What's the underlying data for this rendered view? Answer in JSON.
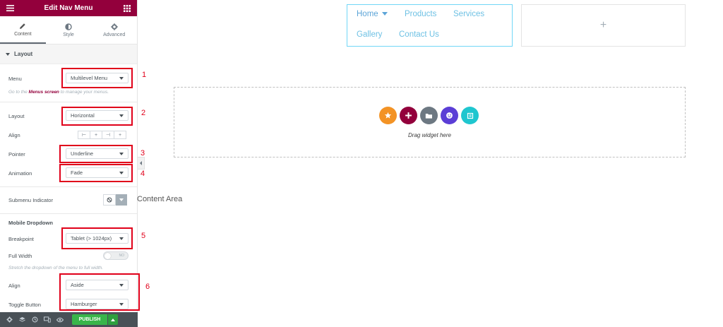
{
  "panel": {
    "title": "Edit Nav Menu",
    "tabs": [
      {
        "label": "Content",
        "icon": "pencil-icon",
        "active": true
      },
      {
        "label": "Style",
        "icon": "half-circle-icon",
        "active": false
      },
      {
        "label": "Advanced",
        "icon": "gear-icon",
        "active": false
      }
    ],
    "section_title": "Layout",
    "menu": {
      "label": "Menu",
      "value": "Multilevel Menu"
    },
    "menu_hint_prefix": "Go to the ",
    "menu_hint_link": "Menus screen",
    "menu_hint_suffix": " to manage your menus.",
    "layout": {
      "label": "Layout",
      "value": "Horizontal"
    },
    "align": {
      "label": "Align",
      "options": [
        "⊢",
        "+",
        "⊣",
        "+"
      ]
    },
    "pointer": {
      "label": "Pointer",
      "value": "Underline"
    },
    "animation": {
      "label": "Animation",
      "value": "Fade"
    },
    "submenu_indicator": {
      "label": "Submenu Indicator"
    },
    "mobile_dropdown_title": "Mobile Dropdown",
    "breakpoint": {
      "label": "Breakpoint",
      "value": "Tablet (> 1024px)"
    },
    "full_width": {
      "label": "Full Width",
      "toggle_text": "NO"
    },
    "full_width_hint": "Stretch the dropdown of the menu to full width.",
    "dropdown_align": {
      "label": "Align",
      "value": "Aside"
    },
    "toggle_button": {
      "label": "Toggle Button",
      "value": "Hamburger"
    }
  },
  "annotations": [
    "1",
    "2",
    "3",
    "4",
    "5",
    "6"
  ],
  "footer": {
    "publish_label": "PUBLISH",
    "icons": [
      "settings-icon",
      "layers-icon",
      "history-icon",
      "responsive-icon",
      "preview-icon"
    ]
  },
  "preview": {
    "nav_items": [
      "Home",
      "Products",
      "Services",
      "Gallery",
      "Contact Us"
    ],
    "empty_column_symbol": "+",
    "drag_text": "Drag widget here",
    "content_area_label": "Content Area"
  },
  "colors": {
    "brand": "#93003c",
    "annotation_red": "#e0001a",
    "nav_link": "#6ec1e4",
    "publish_green": "#39b54a",
    "footer_bg": "#495157"
  }
}
